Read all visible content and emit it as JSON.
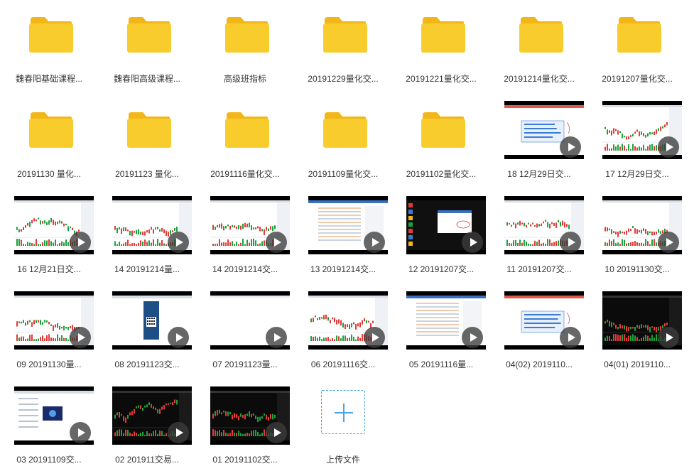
{
  "items": [
    {
      "type": "folder",
      "label": "魏春阳基础课程..."
    },
    {
      "type": "folder",
      "label": "魏春阳高级课程..."
    },
    {
      "type": "folder",
      "label": "高级班指标"
    },
    {
      "type": "folder",
      "label": "20191229量化交..."
    },
    {
      "type": "folder",
      "label": "20191221量化交..."
    },
    {
      "type": "folder",
      "label": "20191214量化交..."
    },
    {
      "type": "folder",
      "label": "20191207量化交..."
    },
    {
      "type": "folder",
      "label": "20191130 量化..."
    },
    {
      "type": "folder",
      "label": "20191123 量化..."
    },
    {
      "type": "folder",
      "label": "20191116量化交..."
    },
    {
      "type": "folder",
      "label": "20191109量化交..."
    },
    {
      "type": "folder",
      "label": "20191102量化交..."
    },
    {
      "type": "video",
      "label": "18 12月29日交...",
      "theme": "slide"
    },
    {
      "type": "video",
      "label": "17 12月29日交...",
      "theme": "light-chart"
    },
    {
      "type": "video",
      "label": "16 12月21日交...",
      "theme": "light-chart"
    },
    {
      "type": "video",
      "label": "14 20191214量...",
      "theme": "light-chart"
    },
    {
      "type": "video",
      "label": "14 20191214交...",
      "theme": "light-chart"
    },
    {
      "type": "video",
      "label": "13 20191214交...",
      "theme": "table"
    },
    {
      "type": "video",
      "label": "12 20191207交...",
      "theme": "desktop"
    },
    {
      "type": "video",
      "label": "11 20191207交...",
      "theme": "light-chart"
    },
    {
      "type": "video",
      "label": "10 20191130交...",
      "theme": "light-chart"
    },
    {
      "type": "video",
      "label": "09 20191130量...",
      "theme": "light-chart"
    },
    {
      "type": "video",
      "label": "08 20191123交...",
      "theme": "qr"
    },
    {
      "type": "video",
      "label": "07 20191123量...",
      "theme": "blank"
    },
    {
      "type": "video",
      "label": "06 20191116交...",
      "theme": "light-chart"
    },
    {
      "type": "video",
      "label": "05 20191116量...",
      "theme": "table"
    },
    {
      "type": "video",
      "label": "04(02) 2019110...",
      "theme": "slide"
    },
    {
      "type": "video",
      "label": "04(01) 2019110...",
      "theme": "dark-chart"
    },
    {
      "type": "video",
      "label": "03 20191109交...",
      "theme": "web"
    },
    {
      "type": "video",
      "label": "02 201911交易...",
      "theme": "dark-chart"
    },
    {
      "type": "video",
      "label": "01 20191102交...",
      "theme": "dark-chart"
    },
    {
      "type": "upload",
      "label": "上传文件"
    }
  ],
  "colors": {
    "folder_body": "#f9cc2e",
    "folder_tab": "#f2b619",
    "accent_blue": "#4aa3e8",
    "label_text": "#333333"
  },
  "icons": {
    "folder": "folder-icon",
    "play": "play-icon",
    "upload": "plus-icon"
  }
}
